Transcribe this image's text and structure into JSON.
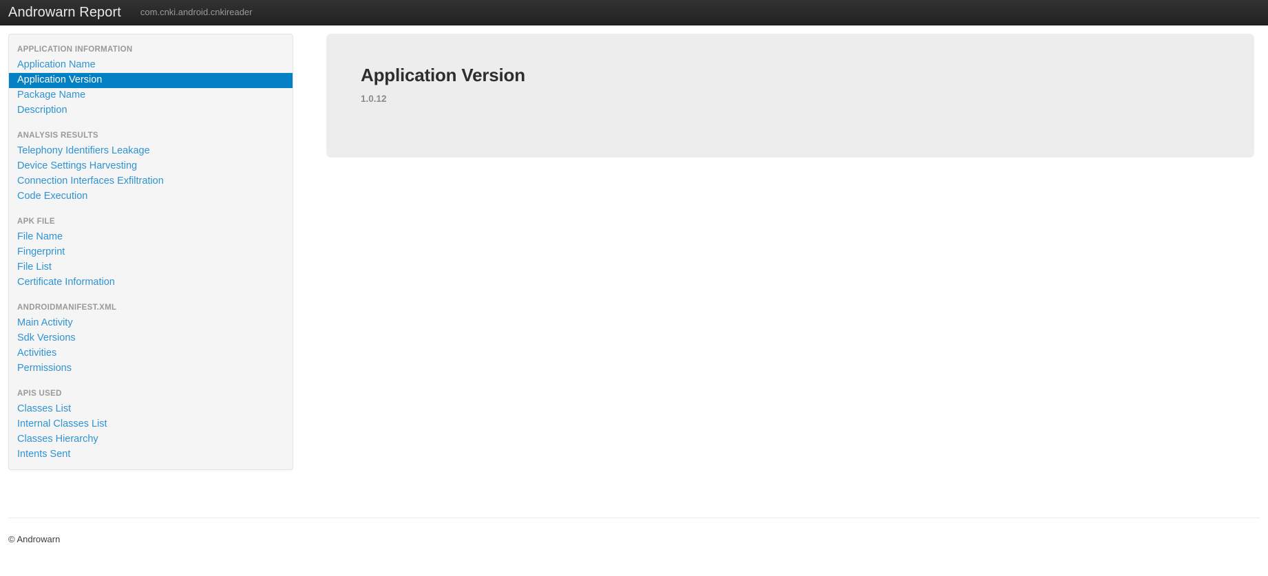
{
  "navbar": {
    "brand": "Androwarn Report",
    "subtitle": "com.cnki.android.cnkireader"
  },
  "sidebar": {
    "groups": [
      {
        "header": "APPLICATION INFORMATION",
        "items": [
          {
            "label": "Application Name",
            "active": false
          },
          {
            "label": "Application Version",
            "active": true
          },
          {
            "label": "Package Name",
            "active": false
          },
          {
            "label": "Description",
            "active": false
          }
        ]
      },
      {
        "header": "ANALYSIS RESULTS",
        "items": [
          {
            "label": "Telephony Identifiers Leakage",
            "active": false
          },
          {
            "label": "Device Settings Harvesting",
            "active": false
          },
          {
            "label": "Connection Interfaces Exfiltration",
            "active": false
          },
          {
            "label": "Code Execution",
            "active": false
          }
        ]
      },
      {
        "header": "APK FILE",
        "items": [
          {
            "label": "File Name",
            "active": false
          },
          {
            "label": "Fingerprint",
            "active": false
          },
          {
            "label": "File List",
            "active": false
          },
          {
            "label": "Certificate Information",
            "active": false
          }
        ]
      },
      {
        "header": "ANDROIDMANIFEST.XML",
        "items": [
          {
            "label": "Main Activity",
            "active": false
          },
          {
            "label": "Sdk Versions",
            "active": false
          },
          {
            "label": "Activities",
            "active": false
          },
          {
            "label": "Permissions",
            "active": false
          }
        ]
      },
      {
        "header": "APIS USED",
        "items": [
          {
            "label": "Classes List",
            "active": false
          },
          {
            "label": "Internal Classes List",
            "active": false
          },
          {
            "label": "Classes Hierarchy",
            "active": false
          },
          {
            "label": "Intents Sent",
            "active": false
          }
        ]
      }
    ]
  },
  "main": {
    "title": "Application Version",
    "value": "1.0.12"
  },
  "footer": {
    "copyright": "© Androwarn"
  },
  "colors": {
    "accent": "#0480c4",
    "link": "#2f93d1",
    "navbar_bg": "#282828",
    "panel_bg": "#ededed",
    "sidebar_bg": "#f5f5f5"
  }
}
